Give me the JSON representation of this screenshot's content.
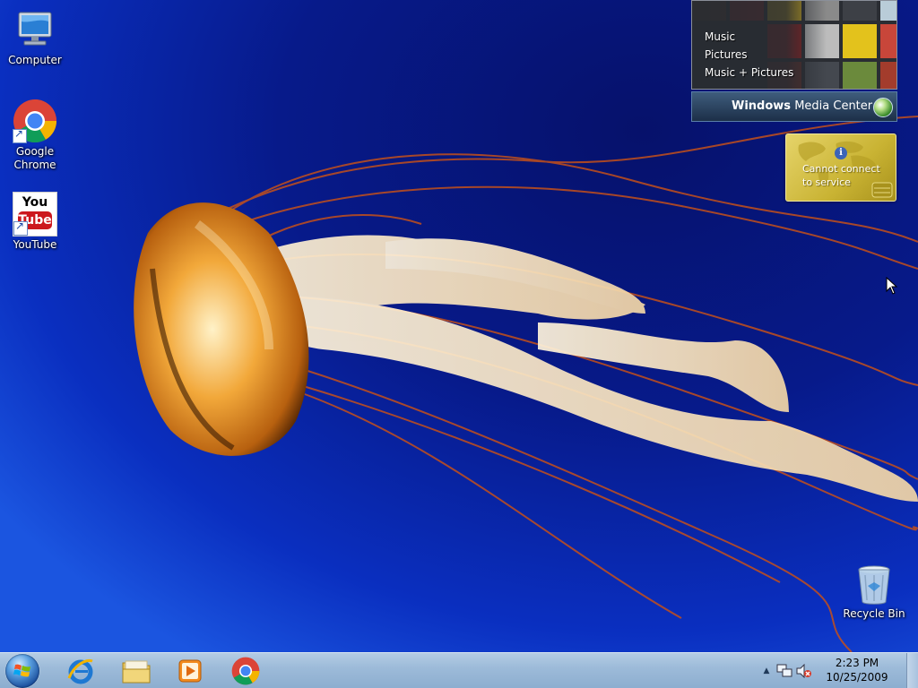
{
  "desktop_icons": {
    "computer": "Computer",
    "chrome": "Google Chrome",
    "youtube": "YouTube",
    "youtube_logo_you": "You",
    "youtube_logo_tube": "Tube",
    "recycle_bin": "Recycle Bin"
  },
  "media_center": {
    "menu": [
      "Music",
      "Pictures",
      "Music + Pictures"
    ],
    "brand_bold": "Windows",
    "brand_rest": "Media Center"
  },
  "service_gadget": {
    "info": "i",
    "message": "Cannot connect to service"
  },
  "taskbar": {
    "pinned": [
      "start-orb",
      "internet-explorer-icon",
      "windows-explorer-icon",
      "media-player-icon",
      "chrome-icon"
    ],
    "clock_time": "2:23 PM",
    "clock_date": "10/25/2009"
  },
  "colors": {
    "wallpaper_deep": "#06116b",
    "wallpaper_light": "#1b55e0",
    "jellyfish_orange": "#e08a1e",
    "taskbar": "#9dbbd9",
    "gadget_gold": "#c9b333"
  }
}
